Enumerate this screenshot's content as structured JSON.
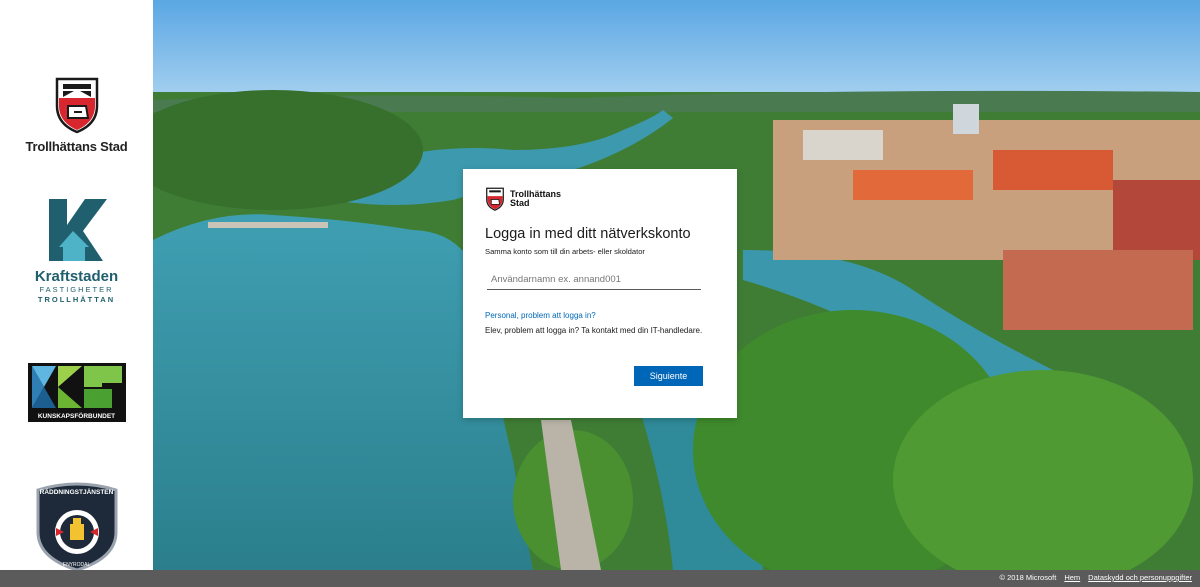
{
  "sidebar": {
    "logos": [
      {
        "name": "Trollhättans Stad"
      },
      {
        "name": "Kraftstaden",
        "sub1": "FASTIGHETER",
        "sub2": "TROLLHÄTTAN"
      },
      {
        "name": "KUNSKAPSFÖRBUNDET"
      },
      {
        "top": "RÄDDNINGSTJÄNSTEN",
        "bottom": "ENYRODAL"
      }
    ]
  },
  "card": {
    "brand": "Trollhättans Stad",
    "title": "Logga in med ditt nätverkskonto",
    "subtitle": "Samma konto som till din arbets- eller skoldator",
    "username_placeholder": "Användarnamn ex. annand001",
    "staff_link": "Personal, problem att logga in?",
    "student_text": "Elev, problem att logga in? Ta kontakt med din IT-handledare.",
    "next_label": "Siguiente"
  },
  "footer": {
    "copyright": "© 2018 Microsoft",
    "home": "Hem",
    "privacy": "Dataskydd och personuppgifter"
  },
  "colors": {
    "accent": "#0067b8",
    "footer": "#5b5b5b",
    "brand_red": "#d8262e",
    "kraft_teal": "#1f5f6e"
  }
}
